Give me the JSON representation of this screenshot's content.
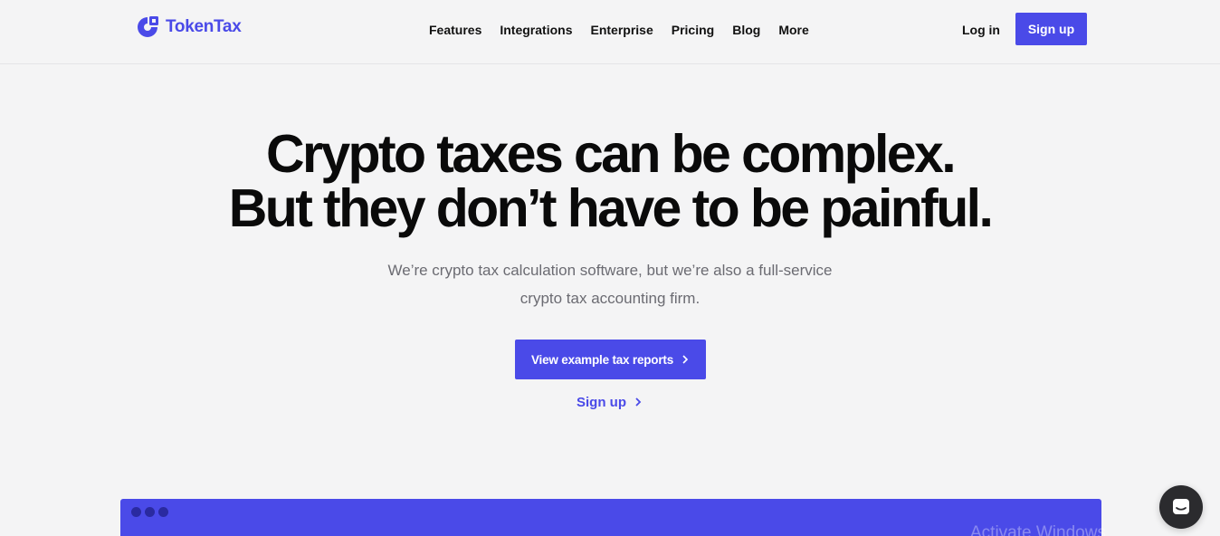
{
  "brand": {
    "name": "TokenTax",
    "color": "#4a4ae8"
  },
  "nav": {
    "items": [
      {
        "label": "Features"
      },
      {
        "label": "Integrations"
      },
      {
        "label": "Enterprise"
      },
      {
        "label": "Pricing"
      },
      {
        "label": "Blog"
      },
      {
        "label": "More"
      }
    ],
    "login_label": "Log in",
    "signup_label": "Sign up"
  },
  "hero": {
    "title_line1": "Crypto taxes can be complex.",
    "title_line2": "But they don’t have to be painful.",
    "subtitle": "We’re crypto tax calculation software, but we’re also a full-service crypto tax accounting firm.",
    "primary_cta": "View example tax reports",
    "secondary_cta": "Sign up"
  },
  "overlay": {
    "watermark": "Activate Windows"
  },
  "icons": {
    "logo": "tokentax-logo-icon",
    "chevron": "chevron-right-icon",
    "chat": "chat-icon"
  }
}
